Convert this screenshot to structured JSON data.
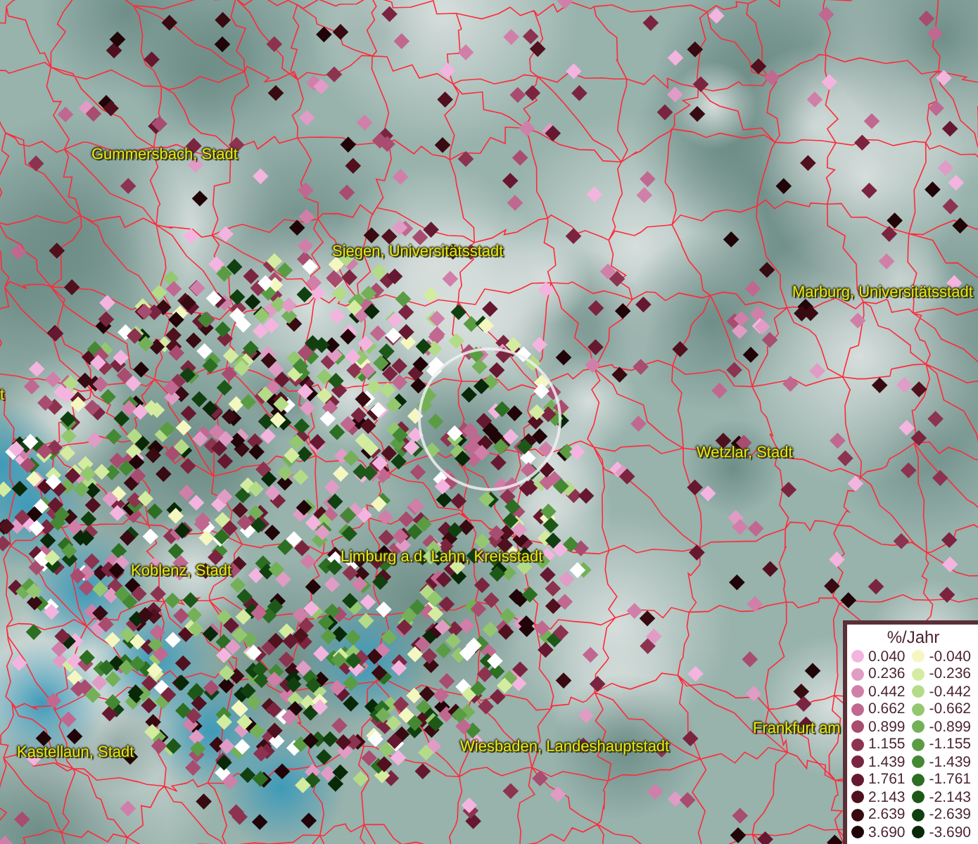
{
  "map": {
    "places": [
      {
        "name": "Gummersbach, Stadt"
      },
      {
        "name": "Siegen, Universitätsstadt"
      },
      {
        "name": "Marburg, Universitätsstadt"
      },
      {
        "name": "t"
      },
      {
        "name": "Wetzlar, Stadt"
      },
      {
        "name": "Limburg a.d. Lahn, Kreisstadt"
      },
      {
        "name": "Koblenz, Stadt"
      },
      {
        "name": "Frankfurt am"
      },
      {
        "name": "Kastellaun, Stadt"
      },
      {
        "name": "Wiesbaden, Landeshauptstadt"
      }
    ]
  },
  "legend": {
    "title": "%/Jahr",
    "positive": [
      {
        "value": "0.040",
        "color": "#f4b4e0"
      },
      {
        "value": "0.236",
        "color": "#e09cc4"
      },
      {
        "value": "0.442",
        "color": "#d07fa8"
      },
      {
        "value": "0.662",
        "color": "#c06890"
      },
      {
        "value": "0.899",
        "color": "#a84c70"
      },
      {
        "value": "1.155",
        "color": "#8c3350"
      },
      {
        "value": "1.439",
        "color": "#7a2440"
      },
      {
        "value": "1.761",
        "color": "#661830"
      },
      {
        "value": "2.143",
        "color": "#50101e"
      },
      {
        "value": "2.639",
        "color": "#380a12"
      },
      {
        "value": "3.690",
        "color": "#200408"
      }
    ],
    "negative": [
      {
        "value": "-0.040",
        "color": "#f4f8c0"
      },
      {
        "value": "-0.236",
        "color": "#d4eca0"
      },
      {
        "value": "-0.442",
        "color": "#b4dc88"
      },
      {
        "value": "-0.662",
        "color": "#94c870"
      },
      {
        "value": "-0.899",
        "color": "#74b058"
      },
      {
        "value": "-1.155",
        "color": "#5a9c44"
      },
      {
        "value": "-1.439",
        "color": "#448834"
      },
      {
        "value": "-1.761",
        "color": "#2c6e22"
      },
      {
        "value": "-2.143",
        "color": "#1e5818"
      },
      {
        "value": "-2.639",
        "color": "#104010"
      },
      {
        "value": "-3.690",
        "color": "#082808"
      }
    ]
  }
}
